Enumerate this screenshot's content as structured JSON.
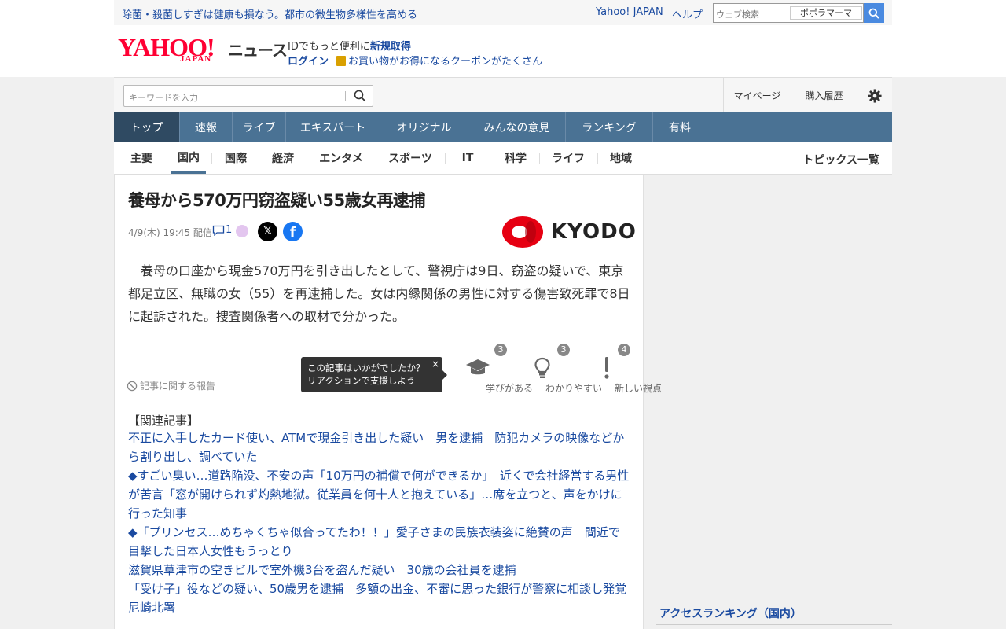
{
  "topbar": {
    "notice": "除菌・殺菌しすぎは健康も損なう。都市の微生物多様性を高める",
    "yahoo_japan": "Yahoo! JAPAN",
    "help": "ヘルプ",
    "web_search_placeholder": "ウェブ検索",
    "web_search_chip": "ポポラマーマ"
  },
  "header": {
    "logo_text": "YAHOO!",
    "logo_sub": "JAPAN",
    "section_name": "ニュース",
    "id_promo": "IDでもっと便利に",
    "register": "新規取得",
    "login": "ログイン",
    "coupon": "お買い物がお得になるクーポンがたくさん"
  },
  "search": {
    "placeholder": "キーワードを入力",
    "mypage": "マイページ",
    "purchase_history": "購入履歴"
  },
  "main_nav": [
    {
      "label": "トップ",
      "active": true
    },
    {
      "label": "速報",
      "active": false
    },
    {
      "label": "ライブ",
      "active": false
    },
    {
      "label": "エキスパート",
      "active": false
    },
    {
      "label": "オリジナル",
      "active": false
    },
    {
      "label": "みんなの意見",
      "active": false
    },
    {
      "label": "ランキング",
      "active": false
    },
    {
      "label": "有料",
      "active": false
    }
  ],
  "sub_nav": {
    "items": [
      {
        "label": "主要",
        "active": false
      },
      {
        "label": "国内",
        "active": true
      },
      {
        "label": "国際",
        "active": false
      },
      {
        "label": "経済",
        "active": false
      },
      {
        "label": "エンタメ",
        "active": false
      },
      {
        "label": "スポーツ",
        "active": false
      },
      {
        "label": "IT",
        "active": false
      },
      {
        "label": "科学",
        "active": false
      },
      {
        "label": "ライフ",
        "active": false
      },
      {
        "label": "地域",
        "active": false
      }
    ],
    "all_topics": "トピックス一覧"
  },
  "article": {
    "headline": "養母から570万円窃盗疑い55歳女再逮捕",
    "date": "4/9(木) 19:45 配信",
    "comment_count": "1",
    "source": "KYODO",
    "body": "養母の口座から現金570万円を引き出したとして、警視庁は9日、窃盗の疑いで、東京都足立区、無職の女（55）を再逮捕した。女は内縁関係の男性に対する傷害致死罪で8日に起訴された。捜査関係者への取材で分かった。",
    "report_link": "記事に関する報告",
    "tooltip_line1": "この記事はいかがでしたか？",
    "tooltip_line2": "リアクションで支援しよう",
    "tooltip_close": "×",
    "reactions": [
      {
        "label": "学びがある",
        "count": "3",
        "icon": "graduation-cap-icon"
      },
      {
        "label": "わかりやすい",
        "count": "3",
        "icon": "lightbulb-icon"
      },
      {
        "label": "新しい視点",
        "count": "4",
        "icon": "exclamation-icon"
      }
    ],
    "related_heading": "【関連記事】",
    "related": [
      "不正に入手したカード使い、ATMで現金引き出した疑い　男を逮捕　防犯カメラの映像などから割り出し、調べていた",
      "◆すごい臭い…道路陥没、不安の声「10万円の補償で何ができるか」　近くで会社経営する男性が苦言「窓が開けられず灼熱地獄。従業員を何十人と抱えている」…席を立つと、声をかけに行った知事",
      "◆「プリンセス…めちゃくちゃ似合ってたわ！！」愛子さまの民族衣装姿に絶賛の声　間近で目撃した日本人女性もうっとり",
      "滋賀県草津市の空きビルで室外機3台を盗んだ疑い　30歳の会社員を逮捕",
      "「受け子」役などの疑い、50歳男を逮捕　多額の出金、不審に思った銀行が警察に相談し発覚　尼崎北署"
    ]
  },
  "sidebar": {
    "ranking_heading": "アクセスランキング（国内）"
  },
  "colors": {
    "nav_bg": "#4a7294",
    "nav_active": "#2f4a62",
    "link": "#1a4aa0",
    "yahoo_red": "#ff0033",
    "kyodo_red": "#e60012"
  }
}
